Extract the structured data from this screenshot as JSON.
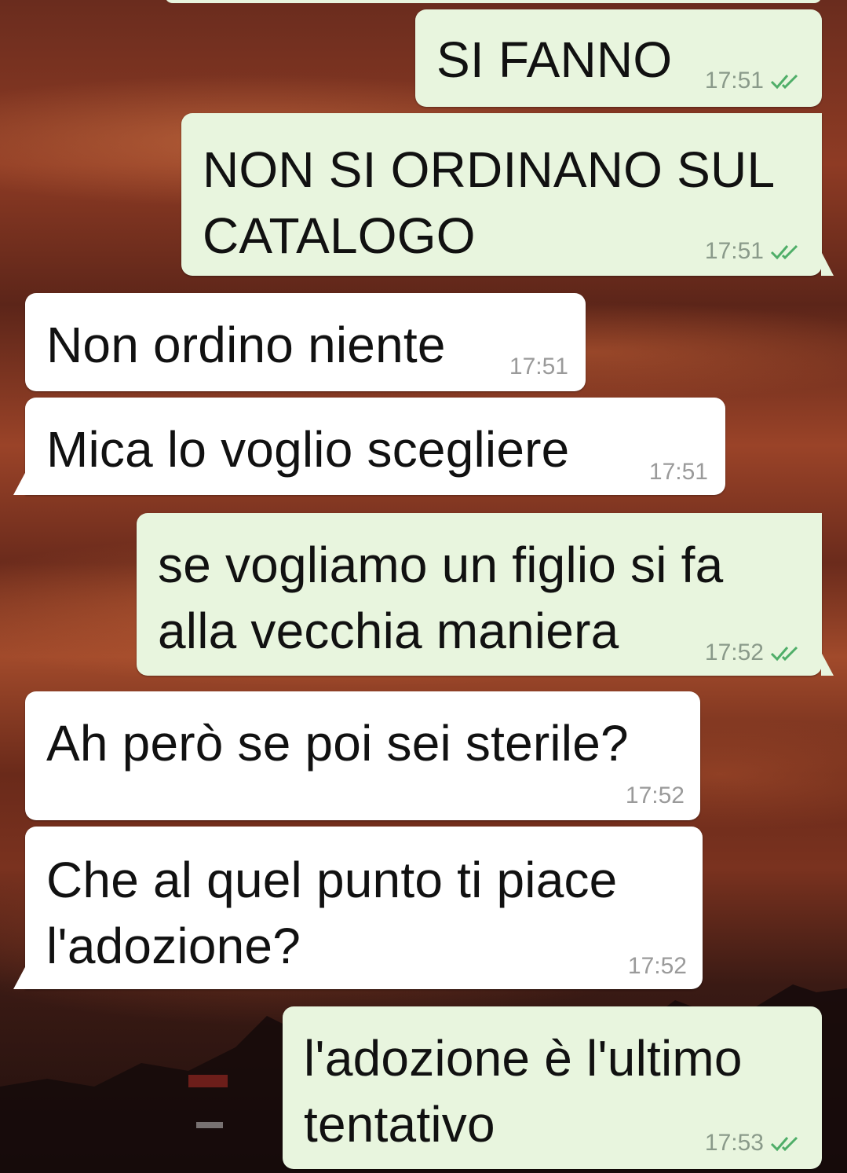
{
  "theme": {
    "outgoing_bubble": "#e8f5de",
    "incoming_bubble": "#ffffff",
    "text_color": "#111111",
    "read_tick_color": "#4fae68"
  },
  "messages": [
    {
      "direction": "outgoing",
      "text": "SI FANNO",
      "time": "17:51",
      "status": "read-ticks-icon"
    },
    {
      "direction": "outgoing",
      "text": "NON SI ORDINANO SUL\nCATALOGO",
      "time": "17:51",
      "status": "read-ticks-icon"
    },
    {
      "direction": "incoming",
      "text": "Non ordino niente",
      "time": "17:51"
    },
    {
      "direction": "incoming",
      "text": "Mica lo voglio scegliere",
      "time": "17:51"
    },
    {
      "direction": "outgoing",
      "text": "se vogliamo un figlio si fa\nalla vecchia maniera",
      "time": "17:52",
      "status": "read-ticks-icon"
    },
    {
      "direction": "incoming",
      "text": "Ah però se poi sei sterile?",
      "time": "17:52"
    },
    {
      "direction": "incoming",
      "text": "Che al quel punto ti piace\nl'adozione?",
      "time": "17:52"
    },
    {
      "direction": "outgoing",
      "text": "l'adozione è l'ultimo\ntentativo",
      "time": "17:53",
      "status": "read-ticks-icon"
    }
  ]
}
